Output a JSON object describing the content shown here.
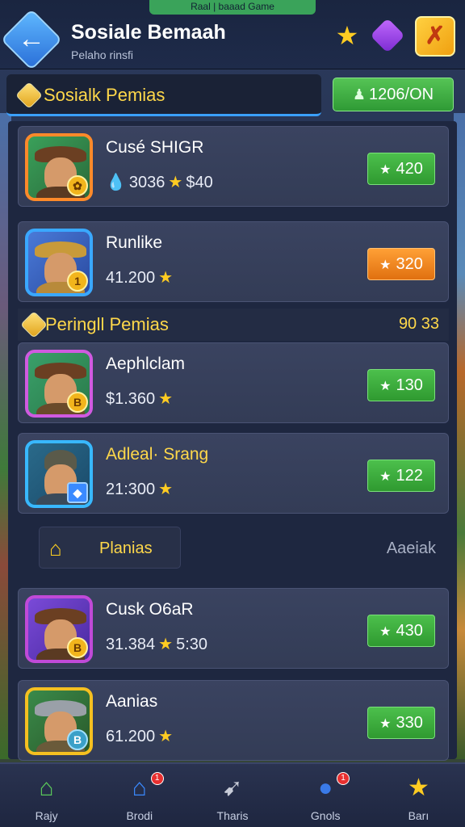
{
  "top_banner": "Raal | baaad Game",
  "header": {
    "title": "Sosiale Bemaah",
    "subtitle": "Pelaho rinsfi"
  },
  "section1": {
    "title": "Sosialk Pemias",
    "count_button": "1206/ON"
  },
  "section2": {
    "title": "Peringll Pemias",
    "value": "90  33"
  },
  "cards": [
    {
      "name": "Cusé SHIGR",
      "stat_primary": "3036",
      "stat_secondary": "$40",
      "reward": "420",
      "reward_color": "#3aa83a"
    },
    {
      "name": "Runlike",
      "stat_primary": "41.200",
      "stat_secondary": "",
      "reward": "320",
      "reward_color": "#f08a20"
    },
    {
      "name": "Aephlclam",
      "stat_primary": "$1.360",
      "stat_secondary": "",
      "reward": "130",
      "reward_color": "#3aa83a"
    },
    {
      "name": "Adleal· Srang",
      "stat_primary": "21:300",
      "stat_secondary": "",
      "reward": "122",
      "reward_color": "#3aa83a"
    },
    {
      "name": "Cusk O6aR",
      "stat_primary": "31.384",
      "stat_secondary": "5:30",
      "reward": "430",
      "reward_color": "#3aa83a"
    },
    {
      "name": "Aanias",
      "stat_primary": "61.200",
      "stat_secondary": "",
      "reward": "330",
      "reward_color": "#3aa83a"
    }
  ],
  "filter": {
    "label": "Planias",
    "side_link": "Aaeiak"
  },
  "nav": [
    {
      "label": "Rajy",
      "icon": "house-icon"
    },
    {
      "label": "Brodi",
      "icon": "shop-icon",
      "badge": "1"
    },
    {
      "label": "Tharis",
      "icon": "bow-icon"
    },
    {
      "label": "Gnols",
      "icon": "social-icon",
      "badge": "1"
    },
    {
      "label": "Barı",
      "icon": "star-icon"
    }
  ]
}
